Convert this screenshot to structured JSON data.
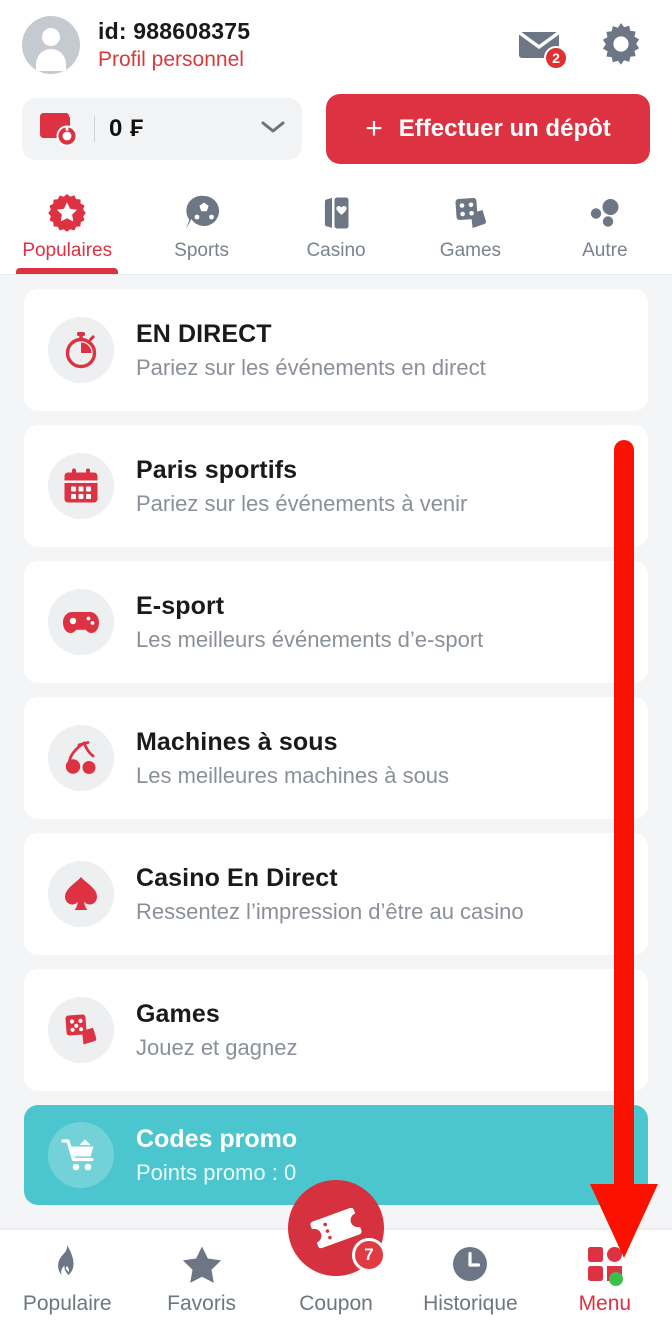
{
  "header": {
    "avatar_icon": "person-avatar-icon",
    "user_id": "id: 988608375",
    "profile_link": "Profil personnel",
    "mail_icon": "envelope-icon",
    "mail_badge": "2",
    "settings_icon": "gear-icon"
  },
  "balance": {
    "wallet_icon": "wallet-refresh-icon",
    "amount": "0 ₣",
    "chevron_icon": "chevron-down-icon",
    "deposit_label": "Effectuer un dépôt",
    "deposit_plus": "+"
  },
  "tabs": [
    {
      "label": "Populaires",
      "icon": "star-badge-icon",
      "active": true
    },
    {
      "label": "Sports",
      "icon": "soccer-ball-icon",
      "active": false
    },
    {
      "label": "Casino",
      "icon": "playing-cards-icon",
      "active": false
    },
    {
      "label": "Games",
      "icon": "dice-icon",
      "active": false
    },
    {
      "label": "Autre",
      "icon": "more-dots-icon",
      "active": false
    }
  ],
  "list": [
    {
      "title": "EN DIRECT",
      "subtitle": "Pariez sur les événements en direct",
      "icon": "stopwatch-icon"
    },
    {
      "title": "Paris sportifs",
      "subtitle": "Pariez sur les événements à venir",
      "icon": "calendar-icon"
    },
    {
      "title": "E-sport",
      "subtitle": "Les meilleurs événements d’e-sport",
      "icon": "gamepad-icon"
    },
    {
      "title": "Machines à sous",
      "subtitle": "Les meilleures machines à sous",
      "icon": "cherry-icon"
    },
    {
      "title": "Casino En Direct",
      "subtitle": "Ressentez l’impression d’être au casino",
      "icon": "spade-icon"
    },
    {
      "title": "Games",
      "subtitle": "Jouez et gagnez",
      "icon": "dice-cards-icon"
    }
  ],
  "promo": {
    "title": "Codes promo",
    "subtitle": "Points promo : 0",
    "icon": "promo-cart-icon"
  },
  "bottom_nav": [
    {
      "label": "Populaire",
      "icon": "flame-icon",
      "active": false
    },
    {
      "label": "Favoris",
      "icon": "star-icon",
      "active": false
    },
    {
      "label": "Coupon",
      "icon": "ticket-icon",
      "active": false,
      "badge": "7"
    },
    {
      "label": "Historique",
      "icon": "clock-icon",
      "active": false
    },
    {
      "label": "Menu",
      "icon": "grid-menu-icon",
      "active": true
    }
  ],
  "annotation": {
    "arrow_icon": "red-down-arrow-annotation",
    "points_to": "Menu"
  },
  "colors": {
    "accent_red": "#DC3242",
    "teal": "#4BC6CE",
    "page_bg": "#F4F5F7",
    "muted_text": "#8A9099",
    "annotation_red": "#FF1A0D"
  }
}
